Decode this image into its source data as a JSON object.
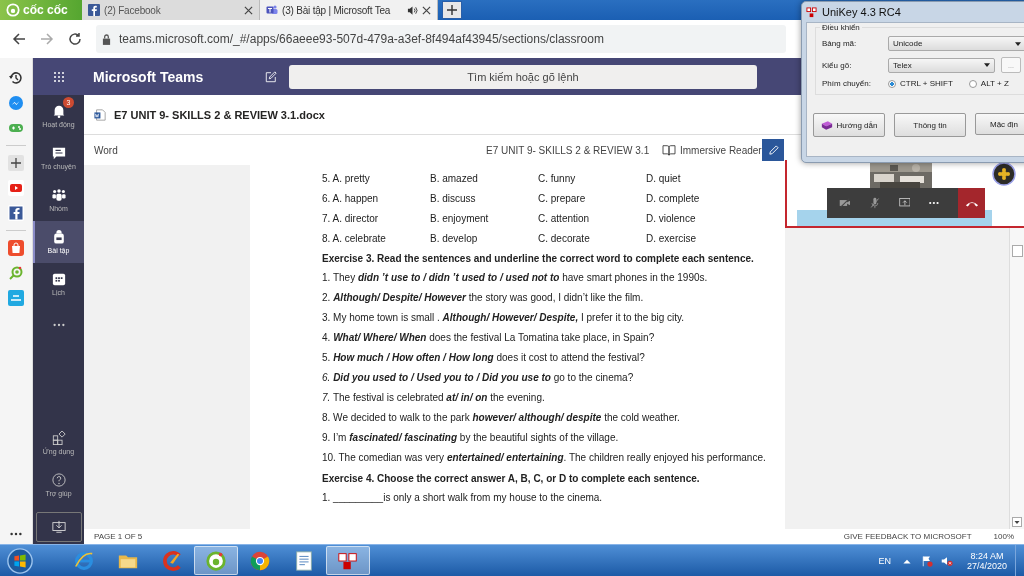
{
  "browser": {
    "brand": "cốc cốc",
    "tabs": [
      {
        "kind": "facebook",
        "title": "(2) Facebook",
        "selected": false,
        "audio": false
      },
      {
        "kind": "teams",
        "title": "(3) Bài tập | Microsoft Tea",
        "selected": true,
        "audio": true
      }
    ],
    "url": "teams.microsoft.com/_#/apps/66aeee93-507d-479a-a3ef-8f494af43945/sections/classroom"
  },
  "teams": {
    "title": "Microsoft Teams",
    "search": {
      "placeholder": "Tìm kiếm hoặc gõ lệnh"
    },
    "rail": [
      {
        "kind": "bell",
        "label": "Hoạt động",
        "badge": "3",
        "selected": false
      },
      {
        "kind": "chat",
        "label": "Trò chuyện",
        "selected": false
      },
      {
        "kind": "people",
        "label": "Nhóm",
        "selected": false
      },
      {
        "kind": "bag",
        "label": "Bài tập",
        "selected": true
      },
      {
        "kind": "calendar",
        "label": "Lịch",
        "selected": false
      }
    ],
    "rail_bottom": [
      {
        "kind": "apps",
        "label": "Ứng dụng"
      },
      {
        "kind": "help",
        "label": "Trợ giúp"
      }
    ],
    "file_name": "E7 UNIT 9- SKILLS 2 & REVIEW 3.1.docx",
    "viewer": {
      "app": "Word",
      "doc_title": "E7 UNIT 9- SKILLS 2 & REVIEW 3.1",
      "immersive_reader": "Immersive Reader"
    },
    "document": {
      "lines": [
        {
          "kind": "options",
          "cells": [
            "5. A. pretty",
            "B. amazed",
            "C. funny",
            "D. quiet"
          ]
        },
        {
          "kind": "options",
          "cells": [
            "6. A. happen",
            "B. discuss",
            "C. prepare",
            "D. complete"
          ]
        },
        {
          "kind": "options",
          "cells": [
            "7. A. director",
            "B. enjoyment",
            "C. attention",
            "D. violence"
          ]
        },
        {
          "kind": "options",
          "cells": [
            "8. A. celebrate",
            "B. develop",
            "C. decorate",
            "D. exercise"
          ]
        },
        {
          "kind": "heading",
          "text": "Exercise 3. Read the sentences and underline the correct word to complete each sentence."
        },
        {
          "kind": "sentence",
          "text": "1.  They **didn ’t use to / didn ’t used to / used not to** have smart phones in the 1990s."
        },
        {
          "kind": "sentence",
          "text": "2. **Although/ Despite/ However** the story was good, I didn’t like the film."
        },
        {
          "kind": "sentence",
          "text": "3. My home town is small . **Although/ However/ Despite,** I prefer it to the big city."
        },
        {
          "kind": "sentence",
          "text": "4. **What/ Where/ When** does the festival La Tomatina take place, in Spain?"
        },
        {
          "kind": "sentence",
          "text": "5. **How much / How often / How long** does it cost to attend the festival?"
        },
        {
          "kind": "sentence",
          "text": "*6.* **Did you used to / Used you to / Did you use to** go to the cinema?"
        },
        {
          "kind": "sentence",
          "text": "*7.* The festival is celebrated **at/ in/ on** the evening."
        },
        {
          "kind": "sentence",
          "text": "8. We decided to walk to the park **however/ although/ despite** the cold weather."
        },
        {
          "kind": "sentence",
          "text": "9. I’m **fascinated/ fascinating** by the beautiful sights of the village."
        },
        {
          "kind": "sentence",
          "text": "10. The comedian was very **entertained/ entertaining**. The children really enjoyed his performance."
        },
        {
          "kind": "heading",
          "text": "Exercise 4. Choose the correct answer A, B, C, or D to complete each sentence."
        },
        {
          "kind": "sentence",
          "text": "1.  _________is only a short walk from my house to the cinema."
        }
      ]
    },
    "status": {
      "page": "PAGE 1 OF 5",
      "feedback": "GIVE FEEDBACK TO MICROSOFT",
      "zoom": "100%"
    }
  },
  "unikey": {
    "title": "UniKey 4.3 RC4",
    "group": "Điều khiển",
    "fields": [
      {
        "label": "Bảng mã:",
        "value": "Unicode"
      },
      {
        "label": "Kiểu gõ:",
        "value": "Telex"
      }
    ],
    "more_button": "...",
    "switch_label": "Phím chuyển:",
    "radios": [
      {
        "label": "CTRL + SHIFT",
        "selected": true
      },
      {
        "label": "ALT + Z",
        "selected": false
      }
    ],
    "buttons": [
      {
        "kind": "guide",
        "label": "Hướng dẫn"
      },
      {
        "kind": "plain",
        "label": "Thông tin"
      },
      {
        "kind": "plain",
        "label": "Mặc địn"
      }
    ]
  },
  "taskbar": {
    "apps": [
      {
        "kind": "ie",
        "selected": false
      },
      {
        "kind": "folder",
        "selected": false
      },
      {
        "kind": "ccleaner",
        "selected": false
      },
      {
        "kind": "coccoc",
        "selected": true
      },
      {
        "kind": "chrome",
        "selected": false
      },
      {
        "kind": "reader",
        "selected": false
      },
      {
        "kind": "unikey",
        "selected": true
      }
    ],
    "language": "EN",
    "time": "8:24 AM",
    "date": "27/4/2020"
  }
}
